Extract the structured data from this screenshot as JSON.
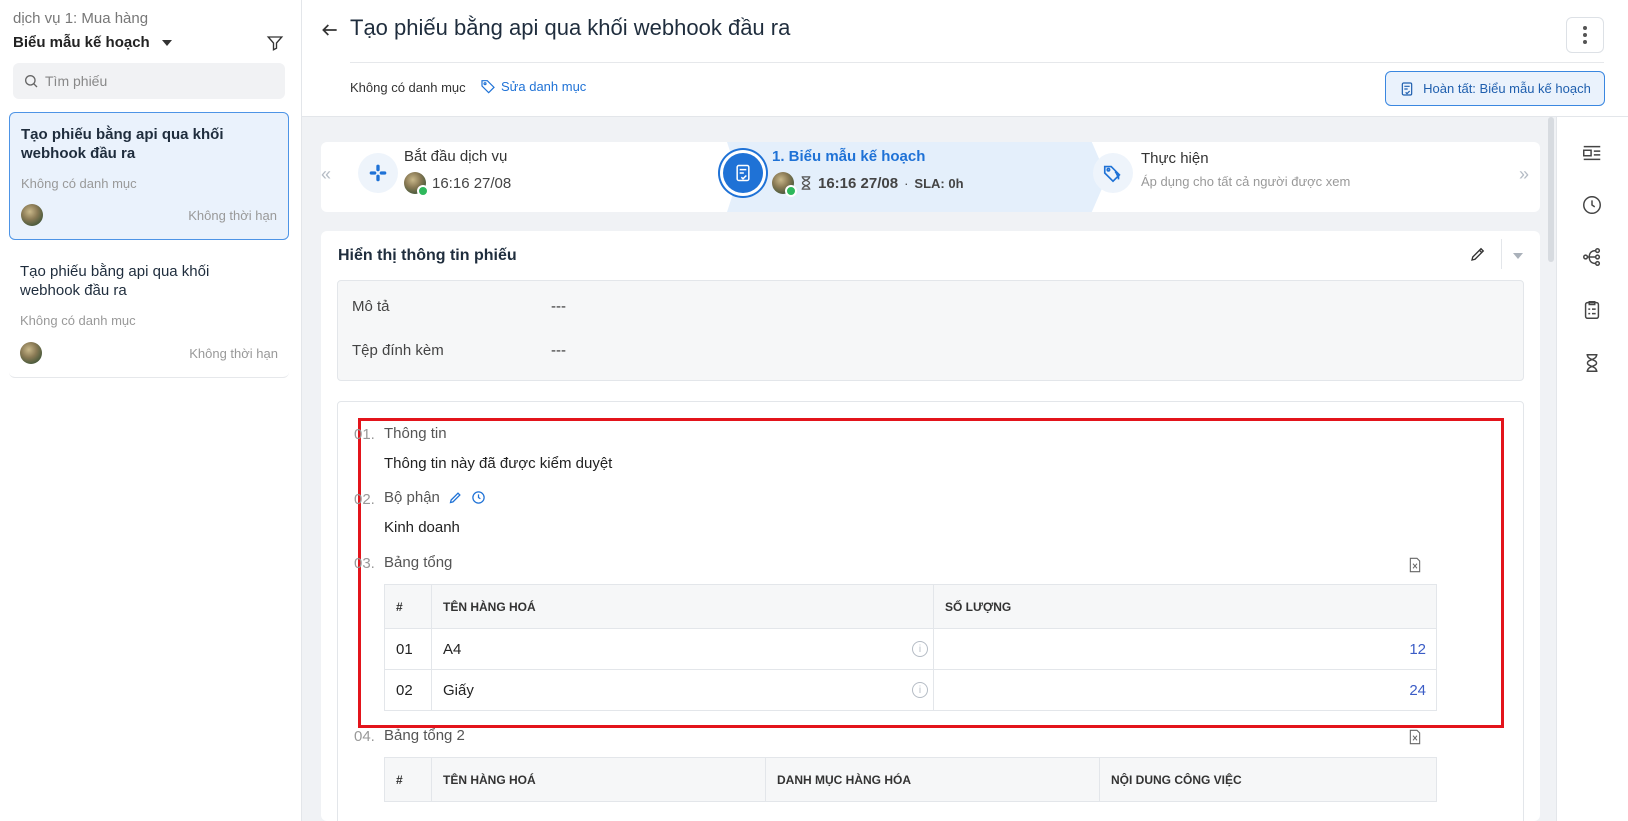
{
  "sidebar": {
    "service": "dịch vụ 1: Mua hàng",
    "form_selector": "Biểu mẫu kế hoạch",
    "search_placeholder": "Tìm phiếu",
    "tickets": [
      {
        "title": "Tạo phiếu bằng api qua khối webhook đầu ra",
        "category": "Không có danh mục",
        "deadline": "Không thời hạn"
      },
      {
        "title": "Tạo phiếu bằng api qua khối webhook đầu ra",
        "category": "Không có danh mục",
        "deadline": "Không thời hạn"
      }
    ]
  },
  "header": {
    "title": "Tạo phiếu bằng api qua khối webhook đầu ra",
    "category": "Không có danh mục",
    "edit_category": "Sửa danh mục",
    "finish_button": "Hoàn tất: Biểu mẫu kế hoạch"
  },
  "steps": [
    {
      "label": "Bắt đầu dịch vụ",
      "time": "16:16 27/08"
    },
    {
      "label": "1. Biểu mẫu kế hoạch",
      "time": "16:16 27/08",
      "sla": "SLA: 0h"
    },
    {
      "label": "Thực hiện",
      "note": "Áp dụng cho tất cả người được xem"
    }
  ],
  "info_card": {
    "title": "Hiển thị thông tin phiếu",
    "meta": [
      {
        "label": "Mô tả",
        "value": "---"
      },
      {
        "label": "Tệp đính kèm",
        "value": "---"
      }
    ]
  },
  "form": {
    "fields": [
      {
        "no": "01.",
        "label": "Thông tin",
        "value": "Thông tin này đã được kiểm duyệt"
      },
      {
        "no": "02.",
        "label": "Bộ phận",
        "value": "Kinh doanh"
      },
      {
        "no": "03.",
        "label": "Bảng tổng"
      },
      {
        "no": "04.",
        "label": "Bảng tổng 2"
      }
    ],
    "table1": {
      "headers": [
        "#",
        "TÊN HÀNG HOÁ",
        "SỐ LƯỢNG"
      ],
      "rows": [
        {
          "idx": "01",
          "name": "A4",
          "qty": "12"
        },
        {
          "idx": "02",
          "name": "Giấy",
          "qty": "24"
        }
      ]
    },
    "table2": {
      "headers": [
        "#",
        "TÊN HÀNG HOÁ",
        "DANH MỤC HÀNG HÓA",
        "NỘI DUNG CÔNG VIỆC"
      ]
    }
  },
  "colors": {
    "accent": "#1f72d6",
    "highlight": "#e3141b",
    "success": "#2eb85c",
    "number": "#3b5cc6"
  }
}
